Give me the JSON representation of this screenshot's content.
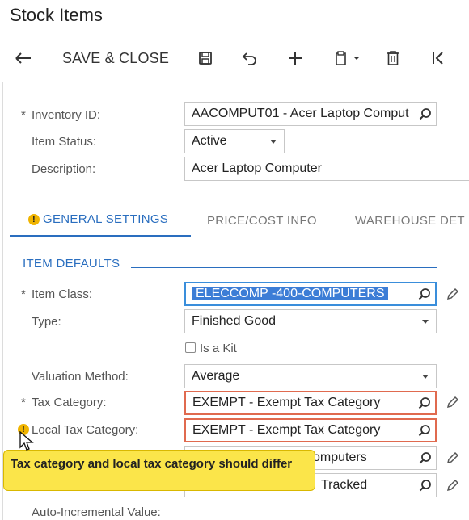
{
  "page": {
    "title": "Stock Items"
  },
  "toolbar": {
    "back_icon": "arrow-left-icon",
    "save_close_label": "SAVE & CLOSE",
    "save_icon": "floppy-disk-icon",
    "undo_icon": "undo-icon",
    "add_icon": "plus-icon",
    "copy_icon": "clipboard-icon",
    "delete_icon": "trash-icon",
    "first_icon": "first-record-icon"
  },
  "header": {
    "inventory_id": {
      "label": "Inventory ID:",
      "value": "AACOMPUT01 - Acer Laptop Comput",
      "required": "*"
    },
    "item_status": {
      "label": "Item Status:",
      "value": "Active"
    },
    "description": {
      "label": "Description:",
      "value": "Acer Laptop Computer"
    }
  },
  "tabs": [
    {
      "label": "GENERAL SETTINGS",
      "active": true,
      "has_warning": true
    },
    {
      "label": "PRICE/COST INFO",
      "active": false
    },
    {
      "label": "WAREHOUSE DET",
      "active": false
    }
  ],
  "item_defaults": {
    "section_title": "ITEM DEFAULTS",
    "item_class": {
      "label": "Item Class:",
      "value": "ELECCOMP    -400-COMPUTERS",
      "required": "*"
    },
    "type": {
      "label": "Type:",
      "value": "Finished Good"
    },
    "is_kit": {
      "label": "Is a Kit",
      "checked": false
    },
    "valuation_method": {
      "label": "Valuation Method:",
      "value": "Average"
    },
    "tax_category": {
      "label": "Tax Category:",
      "value": "EXEMPT - Exempt Tax Category",
      "required": "*"
    },
    "local_tax_category": {
      "label": "Local Tax Category:",
      "value": "EXEMPT - Exempt Tax Category"
    },
    "posting_class": {
      "value_partial": "omputers"
    },
    "lot_serial_class": {
      "value_partial": "Tracked"
    },
    "auto_incremental": {
      "label": "Auto-Incremental Value:"
    }
  },
  "tooltip": {
    "text": "Tax category and local tax category should differ"
  },
  "colors": {
    "accent": "#2a6ebf",
    "error_border": "#e06a4f",
    "tooltip_bg": "#fbe54a",
    "warning": "#f0b400",
    "selection": "#3c7dd6"
  }
}
